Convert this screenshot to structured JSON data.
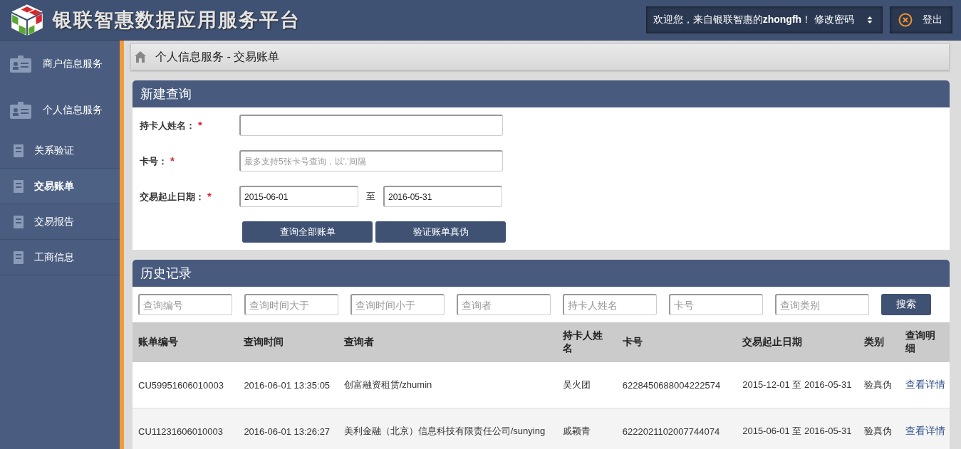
{
  "header": {
    "title": "银联智惠数据应用服务平台",
    "user_menu": "欢迎您，来自银联智惠的**zhongfh**！ 修改密码",
    "logout": "登出"
  },
  "sidebar": {
    "items": [
      {
        "label": "商户信息服务",
        "kind": "large",
        "selected": false
      },
      {
        "label": "个人信息服务",
        "kind": "large",
        "selected": false
      },
      {
        "label": "关系验证",
        "kind": "small",
        "selected": false
      },
      {
        "label": "交易账单",
        "kind": "small",
        "selected": true
      },
      {
        "label": "交易报告",
        "kind": "small",
        "selected": false
      },
      {
        "label": "工商信息",
        "kind": "small",
        "selected": false
      }
    ]
  },
  "breadcrumb": "个人信息服务 - 交易账单",
  "new_query": {
    "title": "新建查询",
    "fields": [
      {
        "label": "持卡人姓名：",
        "required_mark": "*",
        "kind": "text"
      },
      {
        "label": "卡号：",
        "required_mark": "*",
        "kind": "text",
        "placeholder": "最多支持5张卡号查询，以','间隔"
      },
      {
        "label": "交易起止日期：",
        "required_mark": "*",
        "kind": "range",
        "from": "2015-06-01",
        "separator": "至",
        "to": "2016-05-31"
      }
    ],
    "buttons": [
      "查询全部账单",
      "验证账单真伪"
    ]
  },
  "history": {
    "title": "历史记录",
    "filters": [
      {
        "placeholder": "查询编号"
      },
      {
        "placeholder": "查询时间大于"
      },
      {
        "placeholder": "查询时间小于"
      },
      {
        "placeholder": "查询者"
      },
      {
        "placeholder": "持卡人姓名"
      },
      {
        "placeholder": "卡号"
      },
      {
        "placeholder": "查询类别"
      }
    ],
    "search_button": "搜索",
    "table": {
      "columns": [
        "账单编号",
        "查询时间",
        "查询者",
        "持卡人姓名",
        "卡号",
        "交易起止日期",
        "类别",
        "查询明细"
      ],
      "rows": [
        {
          "cells": [
            "CU59951606010003",
            "2016-06-01 13:35:05",
            "创富融资租赁/zhumin",
            "吴火团",
            "6228450688004222574",
            "2015-12-01 至 2016-05-31",
            "验真伪"
          ],
          "link": "查看详情"
        },
        {
          "cells": [
            "CU11231606010003",
            "2016-06-01 13:26:27",
            "美利金融（北京）信息科技有限责任公司/sunying",
            "戚颖青",
            "6222021102007744074",
            "2015-06-01 至 2016-05-31",
            "验真伪"
          ],
          "link": "查看详情"
        }
      ]
    }
  }
}
